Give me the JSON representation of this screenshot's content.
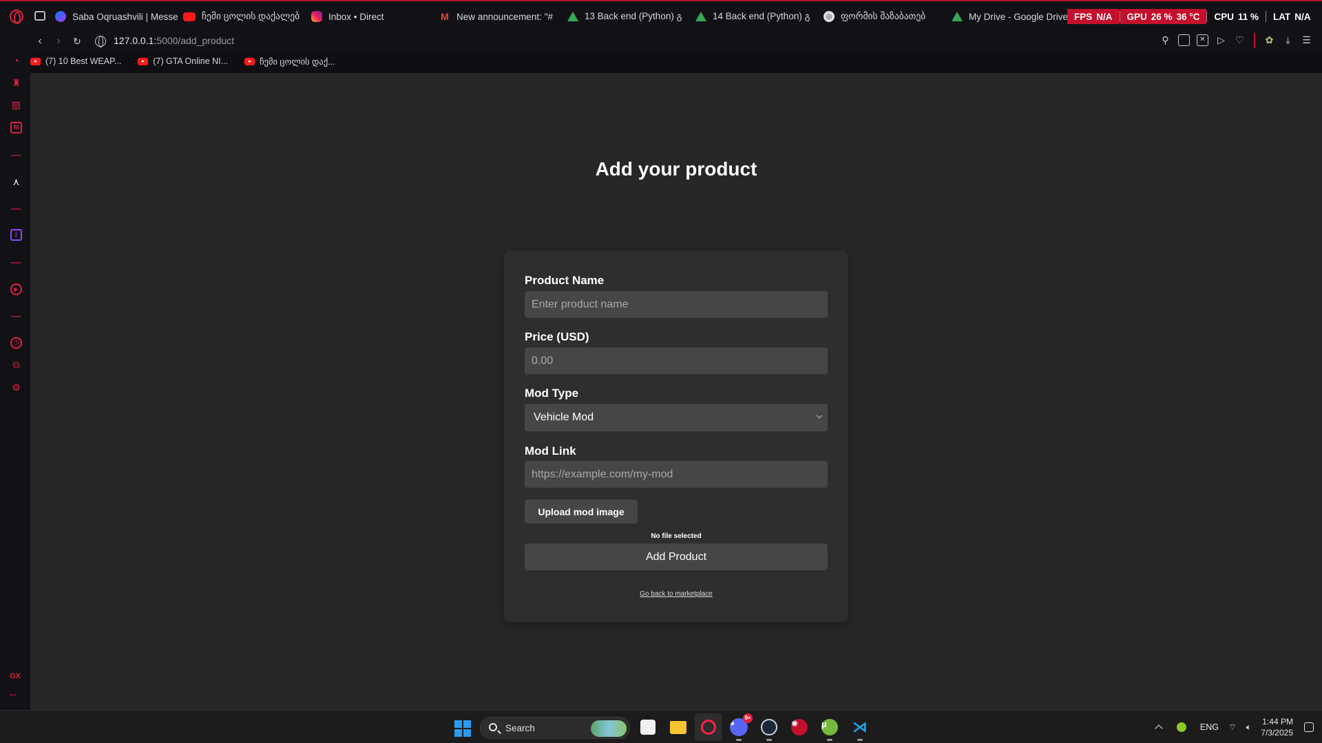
{
  "colors": {
    "accent": "#e1213f",
    "page_bg": "#272727",
    "card_bg": "#2e2e2e",
    "input_bg": "#464646"
  },
  "tabs": [
    {
      "icon": "messenger-icon",
      "label": "Saba Oqruashvili | Messe"
    },
    {
      "icon": "youtube-icon",
      "label": "ჩემი ცოლის დაქალებ"
    },
    {
      "icon": "instagram-icon",
      "label": "Inbox • Direct"
    },
    {
      "icon": "gmail-icon",
      "label": "New announcement: \"#"
    },
    {
      "icon": "google-drive-icon",
      "label": "13 Back end (Python) გ"
    },
    {
      "icon": "google-drive-icon",
      "label": "14 Back end (Python) გ"
    },
    {
      "icon": "site-icon",
      "label": "ფორმის შაზაბათებ"
    },
    {
      "icon": "google-drive-icon",
      "label": "My Drive - Google Drive"
    }
  ],
  "hardware_overlay": {
    "fps_label": "FPS",
    "fps_value": "N/A",
    "gpu_label": "GPU",
    "gpu_value": "26 %",
    "gpu_temp": "36 °C",
    "cpu_label": "CPU",
    "cpu_value": "11 %",
    "lat_label": "LAT",
    "lat_value": "N/A"
  },
  "address": {
    "host": "127.0.0.1:",
    "path": "5000/add_product"
  },
  "bookmarks": [
    {
      "icon": "youtube-icon",
      "label": "(7) 10 Best WEAP..."
    },
    {
      "icon": "youtube-icon",
      "label": "(7) GTA Online NI..."
    },
    {
      "icon": "youtube-icon",
      "label": "ჩემი ცოლის დაქ..."
    }
  ],
  "sidebar": {
    "gx_label": "GX",
    "more_label": "..."
  },
  "page": {
    "title": "Add your product"
  },
  "form": {
    "product_name": {
      "label": "Product Name",
      "placeholder": "Enter product name",
      "value": ""
    },
    "price": {
      "label": "Price (USD)",
      "placeholder": "0.00",
      "value": ""
    },
    "mod_type": {
      "label": "Mod Type",
      "selected": "Vehicle Mod"
    },
    "mod_link": {
      "label": "Mod Link",
      "placeholder": "https://example.com/my-mod",
      "value": ""
    },
    "upload_label": "Upload mod image",
    "file_status": "No file selected",
    "submit_label": "Add Product",
    "back_link": "Go back to marketplace"
  },
  "taskbar": {
    "search_placeholder": "Search",
    "discord_badge": "9+",
    "apps": [
      "windows-start",
      "search",
      "microsoft-store",
      "file-explorer",
      "opera-gx",
      "discord",
      "steam",
      "red-app",
      "utorrent",
      "vscode"
    ]
  },
  "tray": {
    "language": "ENG",
    "time": "1:44 PM",
    "date": "7/3/2025"
  }
}
